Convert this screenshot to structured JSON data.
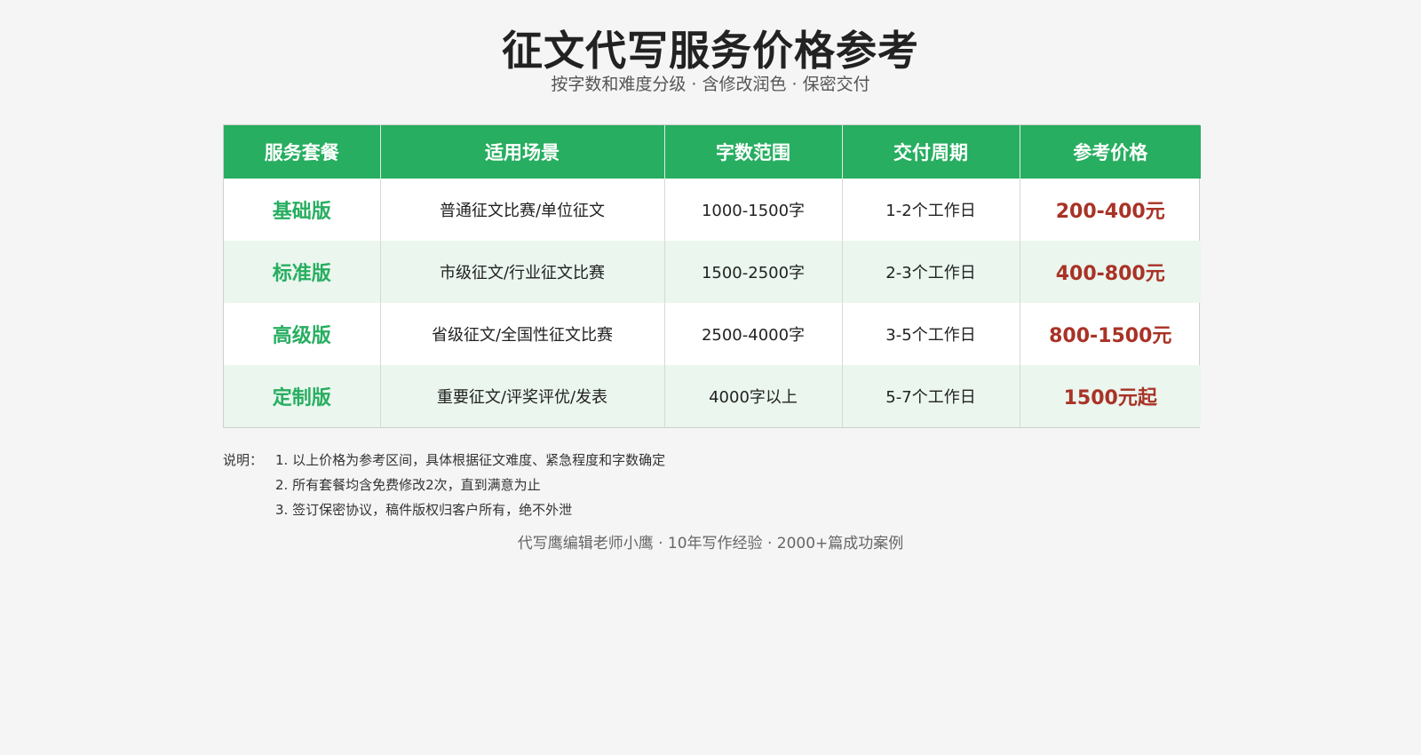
{
  "header": {
    "title": "征文代写服务价格参考",
    "subtitle": "按字数和难度分级 · 含修改润色 · 保密交付"
  },
  "table": {
    "columns": [
      "服务套餐",
      "适用场景",
      "字数范围",
      "交付周期",
      "参考价格"
    ],
    "rows": [
      {
        "package": "基础版",
        "scene": "普通征文比赛/单位征文",
        "words": "1000-1500字",
        "period": "1-2个工作日",
        "price": "200-400元"
      },
      {
        "package": "标准版",
        "scene": "市级征文/行业征文比赛",
        "words": "1500-2500字",
        "period": "2-3个工作日",
        "price": "400-800元"
      },
      {
        "package": "高级版",
        "scene": "省级征文/全国性征文比赛",
        "words": "2500-4000字",
        "period": "3-5个工作日",
        "price": "800-1500元"
      },
      {
        "package": "定制版",
        "scene": "重要征文/评奖评优/发表",
        "words": "4000字以上",
        "period": "5-7个工作日",
        "price": "1500元起"
      }
    ]
  },
  "notes": {
    "label": "说明：",
    "items": [
      "1. 以上价格为参考区间，具体根据征文难度、紧急程度和字数确定",
      "2. 所有套餐均含免费修改2次，直到满意为止",
      "3. 签订保密协议，稿件版权归客户所有，绝不外泄"
    ]
  },
  "footer": {
    "text": "代写鹰编辑老师小鹰 · 10年写作经验 · 2000+篇成功案例"
  },
  "colors": {
    "header_bg": "#27ae60",
    "package_text": "#27ae60",
    "price_text": "#a93226",
    "alt_row_bg": "#eaf6ee"
  }
}
